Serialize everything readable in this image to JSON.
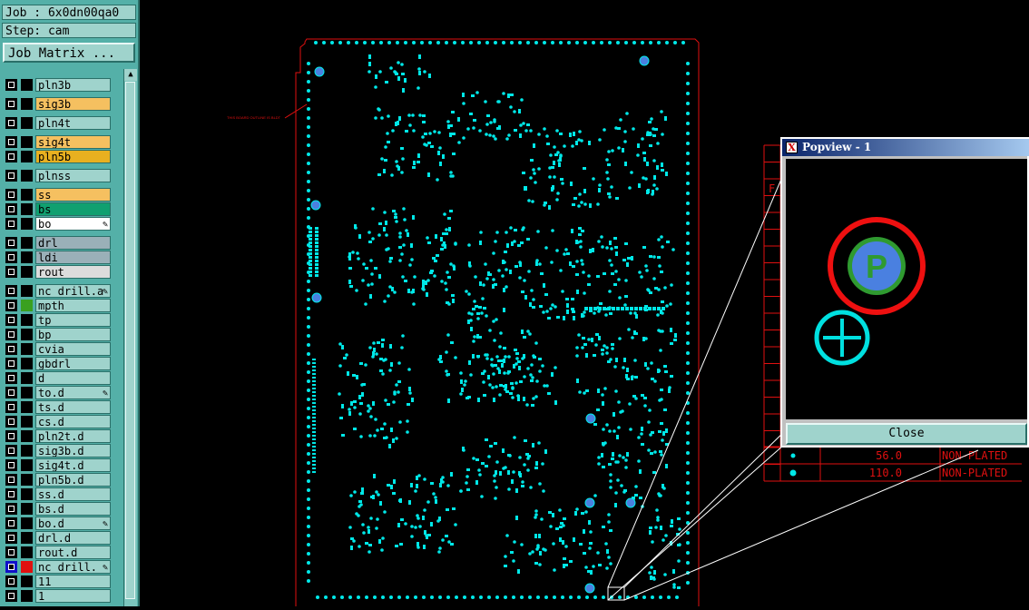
{
  "job": {
    "label": "Job : 6x0dn00qa0",
    "step": "Step: cam"
  },
  "job_matrix_button": "Job Matrix ...",
  "layers": [
    {
      "name": "pln3b",
      "color": "#9fd3cc",
      "swatch": "#000000",
      "mark": ""
    },
    {
      "name": "sig3b",
      "color": "#f5c060",
      "swatch": "#000000",
      "mark": ""
    },
    {
      "name": "pln4t",
      "color": "#9fd3cc",
      "swatch": "#000000",
      "mark": ""
    },
    {
      "name": "sig4t",
      "color": "#f5c060",
      "swatch": "#000000",
      "mark": ""
    },
    {
      "name": "pln5b",
      "color": "#e8b020",
      "swatch": "#000000",
      "mark": ""
    },
    {
      "name": "plnss",
      "color": "#9fd3cc",
      "swatch": "#000000",
      "mark": ""
    },
    {
      "name": "ss",
      "color": "#f5c060",
      "swatch": "#000000",
      "mark": ""
    },
    {
      "name": "bs",
      "color": "#10a070",
      "swatch": "#000000",
      "mark": ""
    },
    {
      "name": "bo",
      "color": "#ffffff",
      "swatch": "#000000",
      "mark": "✎"
    },
    {
      "name": "drl",
      "color": "#9ab0b8",
      "swatch": "#000000",
      "mark": ""
    },
    {
      "name": "ldi",
      "color": "#9ab0b8",
      "swatch": "#000000",
      "mark": ""
    },
    {
      "name": "rout",
      "color": "#dcdcdc",
      "swatch": "#000000",
      "mark": ""
    },
    {
      "name": "nc_drill.a",
      "color": "#9fd3cc",
      "swatch": "#000000",
      "mark": "✎"
    },
    {
      "name": "mpth",
      "color": "#9fd3cc",
      "swatch": "#3aa020",
      "mark": ""
    },
    {
      "name": "tp",
      "color": "#9fd3cc",
      "swatch": "#000000",
      "mark": ""
    },
    {
      "name": "bp",
      "color": "#9fd3cc",
      "swatch": "#000000",
      "mark": ""
    },
    {
      "name": "cvia",
      "color": "#9fd3cc",
      "swatch": "#000000",
      "mark": ""
    },
    {
      "name": "gbdrl",
      "color": "#9fd3cc",
      "swatch": "#000000",
      "mark": ""
    },
    {
      "name": "d",
      "color": "#9fd3cc",
      "swatch": "#000000",
      "mark": ""
    },
    {
      "name": "to.d",
      "color": "#9fd3cc",
      "swatch": "#000000",
      "mark": "✎"
    },
    {
      "name": "ts.d",
      "color": "#9fd3cc",
      "swatch": "#000000",
      "mark": ""
    },
    {
      "name": "cs.d",
      "color": "#9fd3cc",
      "swatch": "#000000",
      "mark": ""
    },
    {
      "name": "pln2t.d",
      "color": "#9fd3cc",
      "swatch": "#000000",
      "mark": ""
    },
    {
      "name": "sig3b.d",
      "color": "#9fd3cc",
      "swatch": "#000000",
      "mark": ""
    },
    {
      "name": "sig4t.d",
      "color": "#9fd3cc",
      "swatch": "#000000",
      "mark": ""
    },
    {
      "name": "pln5b.d",
      "color": "#9fd3cc",
      "swatch": "#000000",
      "mark": ""
    },
    {
      "name": "ss.d",
      "color": "#9fd3cc",
      "swatch": "#000000",
      "mark": ""
    },
    {
      "name": "bs.d",
      "color": "#9fd3cc",
      "swatch": "#000000",
      "mark": ""
    },
    {
      "name": "bo.d",
      "color": "#9fd3cc",
      "swatch": "#000000",
      "mark": "✎"
    },
    {
      "name": "drl.d",
      "color": "#9fd3cc",
      "swatch": "#000000",
      "mark": ""
    },
    {
      "name": "rout.d",
      "color": "#9fd3cc",
      "swatch": "#000000",
      "mark": ""
    },
    {
      "name": "nc_drill.",
      "color": "#9fd3cc",
      "swatch": "#e01010",
      "mark": "✎"
    },
    {
      "name": "11",
      "color": "#9fd3cc",
      "swatch": "#000000",
      "mark": ""
    },
    {
      "name": "1",
      "color": "#9fd3cc",
      "swatch": "#000000",
      "mark": ""
    }
  ],
  "board_note": "THIS BOARD OUTLINE IS BLDT",
  "popview": {
    "title": "Popview - 1",
    "title_icon": "X",
    "close_label": "Close",
    "pad_letter": "P"
  },
  "drill_table": {
    "rows": [
      {
        "size": "56.0",
        "type": "NON-PLATED"
      },
      {
        "size": "110.0",
        "type": "NON-PLATED"
      }
    ],
    "partial_letter": "F"
  },
  "colors": {
    "pad": "#00e8e8",
    "outline": "#e01010",
    "highlight_pad": "#4a80e0",
    "sidebar": "#54b0a8"
  }
}
